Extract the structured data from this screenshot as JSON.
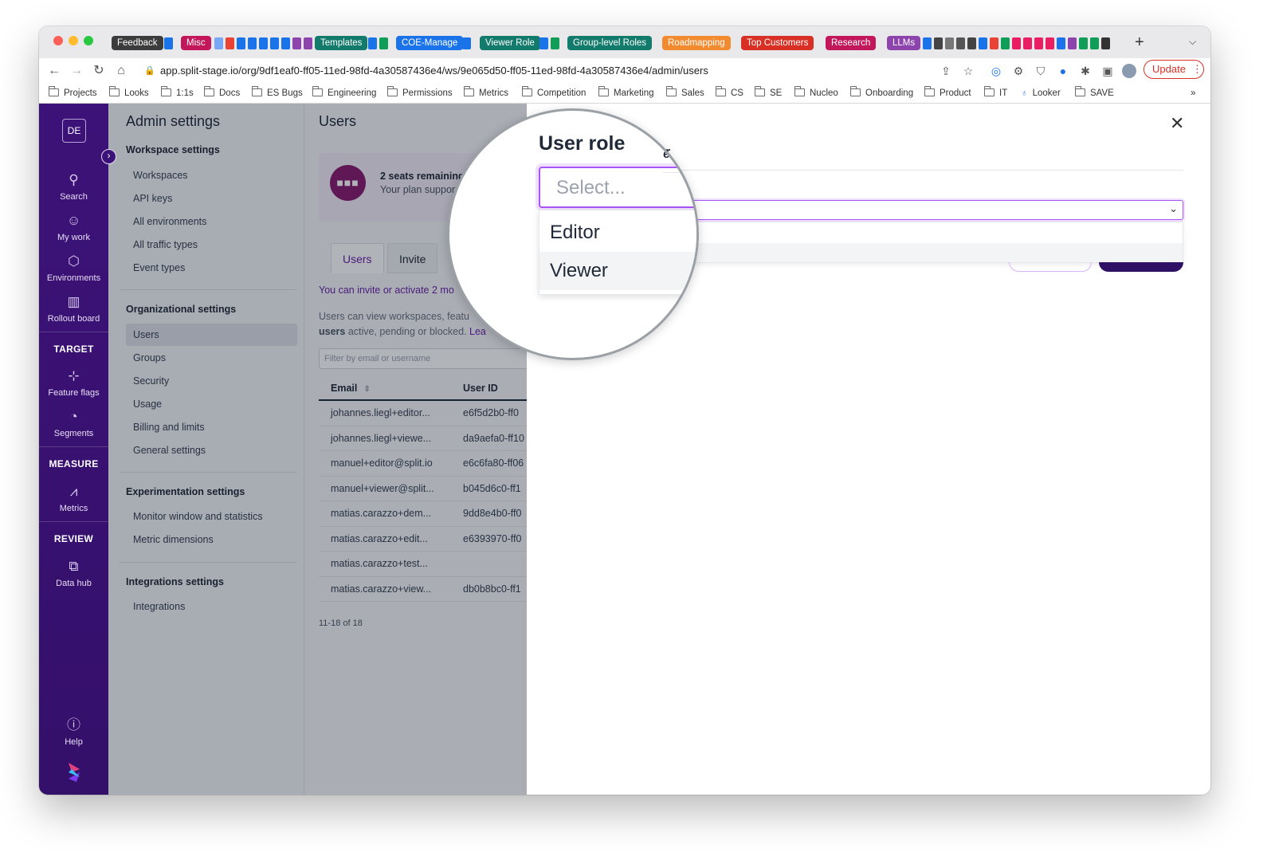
{
  "browser": {
    "tabs": [
      {
        "label": "Feedback",
        "color": "#3c3c3c"
      },
      {
        "label": "Misc",
        "color": "#c2185b"
      },
      {
        "label": "Templates",
        "color": "#137b6c"
      },
      {
        "label": "COE-Manage",
        "color": "#1a73e8"
      },
      {
        "label": "Viewer Role",
        "color": "#137b6c"
      },
      {
        "label": "Group-level Roles",
        "color": "#137b6c"
      },
      {
        "label": "Roadmapping",
        "color": "#f28b30"
      },
      {
        "label": "Top Customers",
        "color": "#d93025"
      },
      {
        "label": "Research",
        "color": "#c2185b"
      },
      {
        "label": "LLMs",
        "color": "#8e44ad"
      }
    ],
    "new_tab": "+",
    "url": "app.split-stage.io/org/9df1eaf0-ff05-11ed-98fd-4a30587436e4/ws/9e065d50-ff05-11ed-98fd-4a30587436e4/admin/users",
    "update_label": "Update",
    "bookmarks": [
      "Projects",
      "Looks",
      "1:1s",
      "Docs",
      "ES Bugs",
      "Engineering",
      "Permissions",
      "Metrics",
      "Competition",
      "Marketing",
      "Sales",
      "CS",
      "SE",
      "Nucleo",
      "Onboarding",
      "Product",
      "IT",
      "Looker",
      "SAVE"
    ],
    "bookmarks_more": "»"
  },
  "nav": {
    "avatar": "DE",
    "items": [
      {
        "label": "Search",
        "icon": "search-icon"
      },
      {
        "label": "My work",
        "icon": "user-icon"
      },
      {
        "label": "Environments",
        "icon": "cube-icon"
      },
      {
        "label": "Rollout board",
        "icon": "columns-icon"
      },
      {
        "label": "Feature flags",
        "icon": "branch-icon"
      },
      {
        "label": "Segments",
        "icon": "pie-icon"
      },
      {
        "label": "Metrics",
        "icon": "chart-icon"
      },
      {
        "label": "Data hub",
        "icon": "data-hub-icon"
      },
      {
        "label": "Help",
        "icon": "help-icon"
      }
    ],
    "sections": [
      "TARGET",
      "MEASURE",
      "REVIEW"
    ]
  },
  "settings": {
    "title": "Admin settings",
    "workspace_group": "Workspace settings",
    "workspace_items": [
      "Workspaces",
      "API keys",
      "All environments",
      "All traffic types",
      "Event types"
    ],
    "org_group": "Organizational settings",
    "org_items": [
      "Users",
      "Groups",
      "Security",
      "Usage",
      "Billing and limits",
      "General settings"
    ],
    "exp_group": "Experimentation settings",
    "exp_items": [
      "Monitor window and statistics",
      "Metric dimensions"
    ],
    "int_group": "Integrations settings",
    "int_items": [
      "Integrations"
    ]
  },
  "users": {
    "title": "Users",
    "seats_title": "2 seats remaining",
    "seats_sub": "Your plan suppor",
    "tab_users": "Users",
    "tab_invite": "Invite",
    "invite_note": "You can invite or activate 2 mo",
    "desc_line1": "Users can view workspaces, featu",
    "desc_bold": "users",
    "desc_line2": " active, pending or blocked. ",
    "desc_link": "Lea",
    "filter_placeholder": "Filter by email or username",
    "col_email": "Email",
    "col_uid": "User ID",
    "sort_icon": "sort-icon",
    "rows": [
      {
        "email": "johannes.liegl+editor...",
        "uid": "e6f5d2b0-ff0"
      },
      {
        "email": "johannes.liegl+viewe...",
        "uid": "da9aefa0-ff10"
      },
      {
        "email": "manuel+editor@split.io",
        "uid": "e6c6fa80-ff06"
      },
      {
        "email": "manuel+viewer@split...",
        "uid": "b045d6c0-ff1"
      },
      {
        "email": "matias.carazzo+dem...",
        "uid": "9dd8e4b0-ff0"
      },
      {
        "email": "matias.carazzo+edit...",
        "uid": "e6393970-ff0"
      },
      {
        "email": "matias.carazzo+test...",
        "uid": ""
      },
      {
        "email": "matias.carazzo+view...",
        "uid": "db0b8bc0-ff1"
      }
    ],
    "pager": "11-18 of 18"
  },
  "drawer": {
    "close_icon": "close-icon",
    "field_label": "User role",
    "placeholder": "Select...",
    "options": [
      "Editor",
      "Viewer"
    ],
    "highlighted_option": "Viewer",
    "peek_text": "er"
  },
  "colors": {
    "accent": "#a855f7",
    "brand": "#3d1278",
    "link": "#6b21a8"
  }
}
